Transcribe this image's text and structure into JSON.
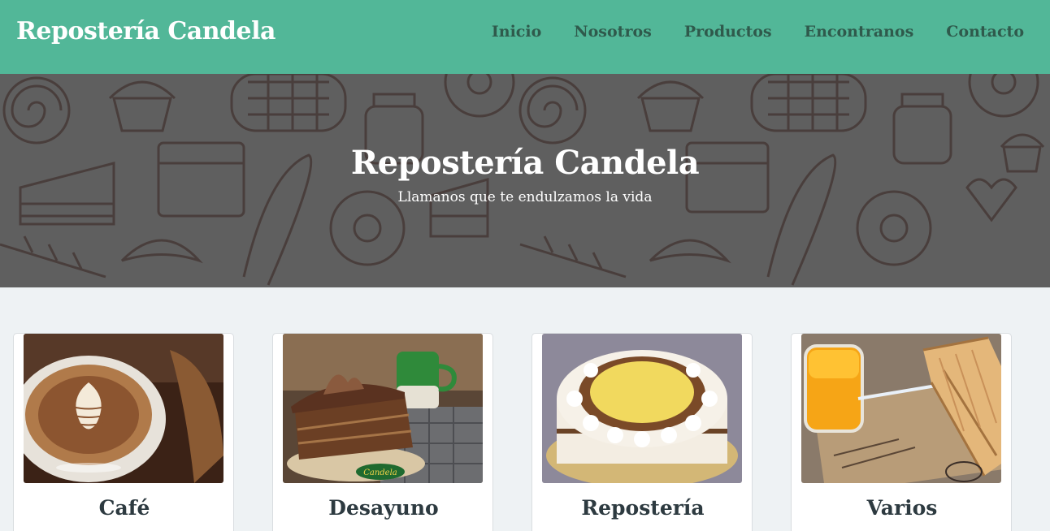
{
  "header": {
    "brand": "Repostería Candela",
    "nav": [
      "Inicio",
      "Nosotros",
      "Productos",
      "Encontranos",
      "Contacto"
    ]
  },
  "hero": {
    "title": "Repostería Candela",
    "subtitle": "Llamanos que te endulzamos la vida"
  },
  "products": [
    {
      "label": "Café",
      "image": "coffee-latte-image"
    },
    {
      "label": "Desayuno",
      "image": "chocolate-cake-slice-image"
    },
    {
      "label": "Repostería",
      "image": "cream-cake-image"
    },
    {
      "label": "Varios",
      "image": "toast-and-orange-juice-image"
    }
  ],
  "colors": {
    "header_bg": "#52b798",
    "nav_text": "#2f5a4c",
    "hero_overlay": "#5b5b5b",
    "page_bg": "#eef2f4",
    "card_title": "#2d3a40"
  }
}
